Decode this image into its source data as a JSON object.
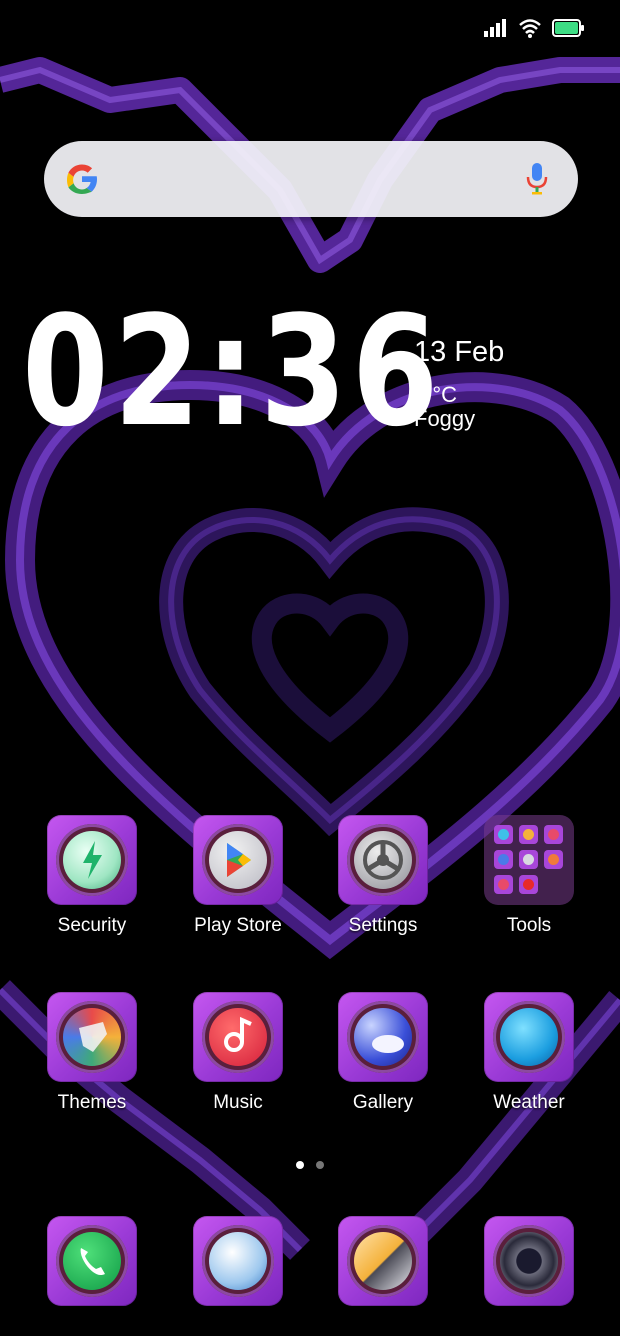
{
  "status_bar": {
    "signal_icon": "signal-icon",
    "wifi_icon": "wifi-icon",
    "battery_icon": "battery-icon",
    "battery_color": "#3ddc84"
  },
  "search_bar": {
    "logo_icon": "google-g-icon",
    "mic_icon": "mic-icon"
  },
  "clock_widget": {
    "time": "02:36",
    "date": "13 Feb",
    "temperature": "8 °C",
    "condition": "Foggy"
  },
  "apps_row1": [
    {
      "label": "Security",
      "icon": "security-icon"
    },
    {
      "label": "Play Store",
      "icon": "play-store-icon"
    },
    {
      "label": "Settings",
      "icon": "settings-icon"
    },
    {
      "label": "Tools",
      "icon": "tools-folder-icon"
    }
  ],
  "apps_row2": [
    {
      "label": "Themes",
      "icon": "themes-icon"
    },
    {
      "label": "Music",
      "icon": "music-icon"
    },
    {
      "label": "Gallery",
      "icon": "gallery-icon"
    },
    {
      "label": "Weather",
      "icon": "weather-icon"
    }
  ],
  "dock": [
    {
      "icon": "phone-icon"
    },
    {
      "icon": "messages-icon"
    },
    {
      "icon": "browser-icon"
    },
    {
      "icon": "camera-icon"
    }
  ],
  "page_indicator": {
    "pages": 2,
    "active": 1
  },
  "colors": {
    "accent": "#a846d9",
    "wallpaper_line": "#6b2fc4",
    "background": "#000000"
  }
}
